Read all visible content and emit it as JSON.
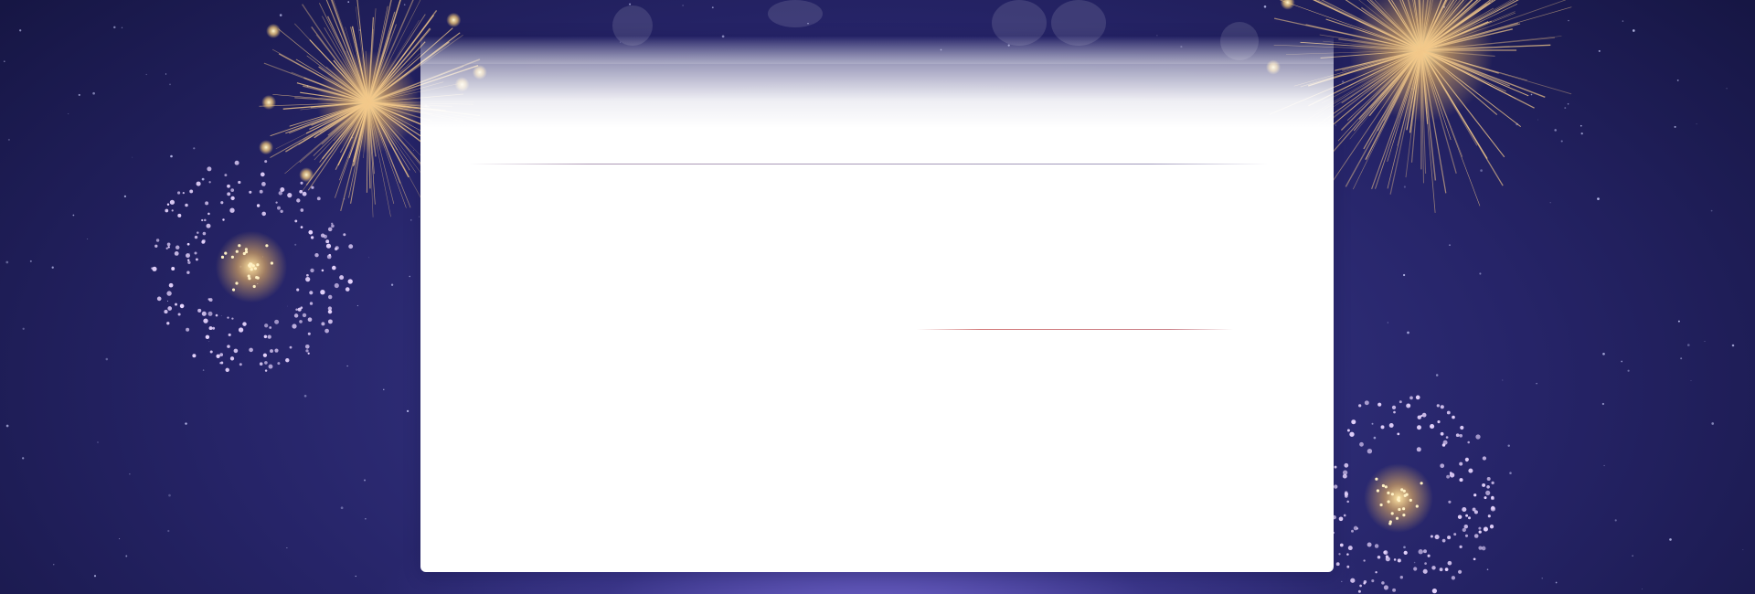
{
  "background": {
    "sky_color": "#262468",
    "glow_color": "#7d6edc"
  },
  "fireworks": [
    {
      "kind": "burst",
      "color": "#f3c98b"
    },
    {
      "kind": "sparkle-ring",
      "color": "#e8d6ff"
    },
    {
      "kind": "burst",
      "color": "#f3c98b"
    },
    {
      "kind": "sparkle-ring",
      "color": "#e8d6ff"
    }
  ],
  "card": {
    "color": "#ffffff"
  }
}
